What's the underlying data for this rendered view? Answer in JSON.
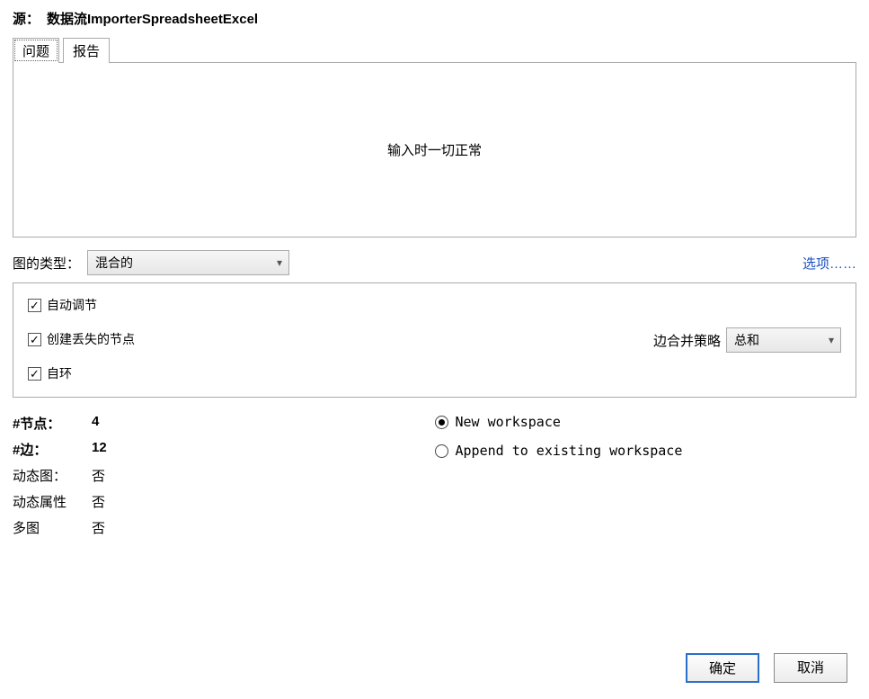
{
  "source": {
    "label": "源：",
    "value": "数据流ImporterSpreadsheetExcel"
  },
  "tabs": {
    "problems": "问题",
    "report": "报告"
  },
  "panel": {
    "message": "输入时一切正常"
  },
  "graphType": {
    "label": "图的类型：",
    "selected": "混合的"
  },
  "optionsLink": "选项……",
  "checkboxes": {
    "autoAdjust": "自动调节",
    "createMissingNodes": "创建丢失的节点",
    "selfLoop": "自环"
  },
  "mergeStrategy": {
    "label": "边合并策略",
    "selected": "总和"
  },
  "stats": {
    "nodesLabel": "#节点：",
    "nodesValue": "4",
    "edgesLabel": "#边：",
    "edgesValue": "12",
    "dynGraphLabel": "动态图：",
    "dynGraphValue": "否",
    "dynAttrLabel": "动态属性",
    "dynAttrValue": "否",
    "multiGraphLabel": "多图",
    "multiGraphValue": "否"
  },
  "workspace": {
    "newWorkspace": "New workspace",
    "append": "Append to existing workspace"
  },
  "buttons": {
    "ok": "确定",
    "cancel": "取消"
  }
}
